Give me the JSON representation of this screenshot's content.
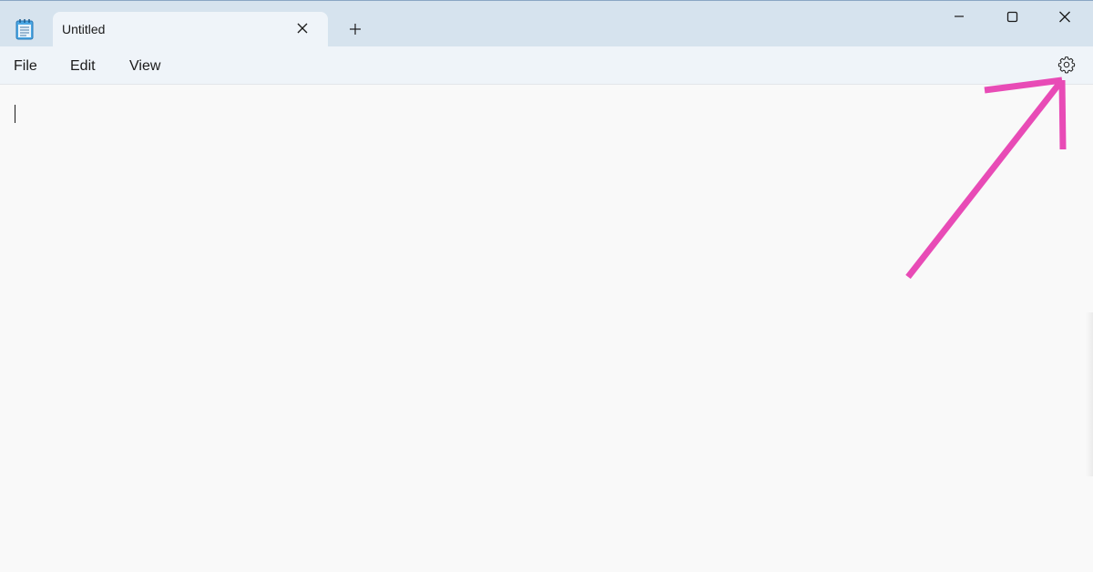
{
  "titlebar": {
    "app_icon": "notepad-icon",
    "tab_title": "Untitled",
    "tab_close_icon": "close-icon",
    "new_tab_icon": "plus-icon",
    "window_controls": {
      "minimize_icon": "minimize-icon",
      "maximize_icon": "maximize-icon",
      "close_icon": "close-icon"
    }
  },
  "menubar": {
    "items": [
      {
        "label": "File"
      },
      {
        "label": "Edit"
      },
      {
        "label": "View"
      }
    ],
    "settings_icon": "gear-icon"
  },
  "editor": {
    "content": ""
  },
  "annotation": {
    "type": "arrow",
    "points_to": "settings",
    "color": "#e84bb6"
  },
  "colors": {
    "titlebar": "#d6e3ee",
    "tab_active": "#eff4f9",
    "menubar": "#eff4f9",
    "editor_bg": "#f9f9f9",
    "text": "#1b1b1b"
  }
}
